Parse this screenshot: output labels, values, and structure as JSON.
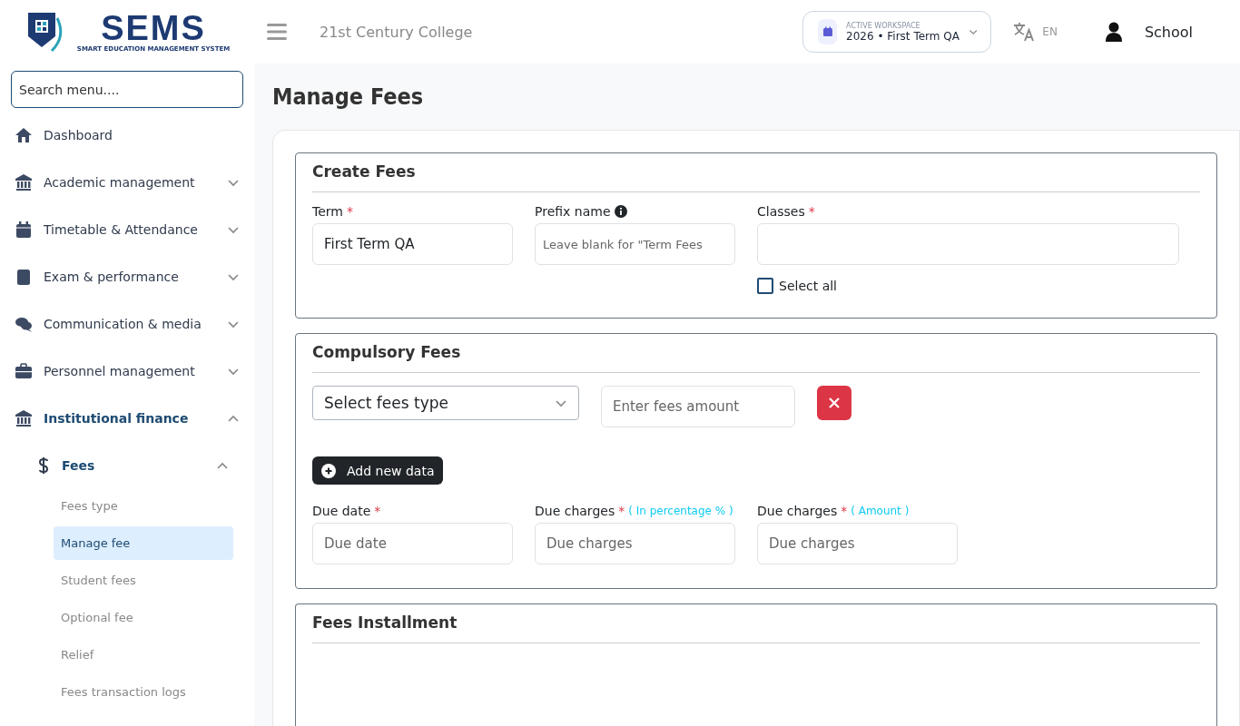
{
  "header": {
    "logo": {
      "title": "SEMS",
      "subtitle": "SMART EDUCATION MANAGEMENT SYSTEM"
    },
    "school": "21st Century College",
    "workspace": {
      "label": "ACTIVE WORKSPACE",
      "value": "2026 • First Term QA"
    },
    "language": "EN",
    "user": "School"
  },
  "sidebar": {
    "search": {
      "placeholder": "Search menu...."
    },
    "items": [
      {
        "label": "Dashboard",
        "selected": false
      },
      {
        "label": "Academic management",
        "selected": false,
        "expanded": false
      },
      {
        "label": "Timetable & Attendance",
        "selected": false,
        "expanded": false
      },
      {
        "label": "Exam & performance",
        "selected": false,
        "expanded": false
      },
      {
        "label": "Communication & media",
        "selected": false,
        "expanded": false
      },
      {
        "label": "Personnel management",
        "selected": false,
        "expanded": false
      },
      {
        "label": "Institutional finance",
        "selected": true,
        "expanded": true,
        "children": [
          {
            "label": "Fees",
            "selected": true,
            "expanded": true,
            "children": [
              {
                "label": "Fees type",
                "selected": false
              },
              {
                "label": "Manage fee",
                "selected": true
              },
              {
                "label": "Student fees",
                "selected": false
              },
              {
                "label": "Optional fee",
                "selected": false
              },
              {
                "label": "Relief",
                "selected": false
              },
              {
                "label": "Fees transaction logs",
                "selected": false
              }
            ]
          }
        ]
      }
    ]
  },
  "page": {
    "title": "Manage Fees",
    "sections": [
      {
        "title": "Create Fees",
        "kind": "create",
        "fields": [
          {
            "label": "Term",
            "required_mark": "*",
            "value": "First Term QA"
          },
          {
            "label": "Prefix name",
            "info": true,
            "placeholder": "Leave blank for \"Term Fees"
          },
          {
            "label": "Classes",
            "required_mark": "*",
            "checkbox": {
              "label": "Select all",
              "checked": false
            }
          }
        ]
      },
      {
        "title": "Compulsory Fees",
        "kind": "compulsory",
        "fee_row": {
          "select": "Select fees type",
          "amount_placeholder": "Enter fees amount"
        },
        "add_button": "Add new data",
        "fields": [
          {
            "label": "Due date",
            "required_mark": "*",
            "placeholder": "Due date"
          },
          {
            "label": "Due charges",
            "required_mark": "*",
            "hint": "( In percentage % )",
            "placeholder": "Due charges"
          },
          {
            "label": "Due charges",
            "required_mark": "*",
            "hint": "( Amount )",
            "placeholder": "Due charges"
          }
        ]
      },
      {
        "title": "Fees Installment",
        "kind": "installment"
      }
    ]
  }
}
